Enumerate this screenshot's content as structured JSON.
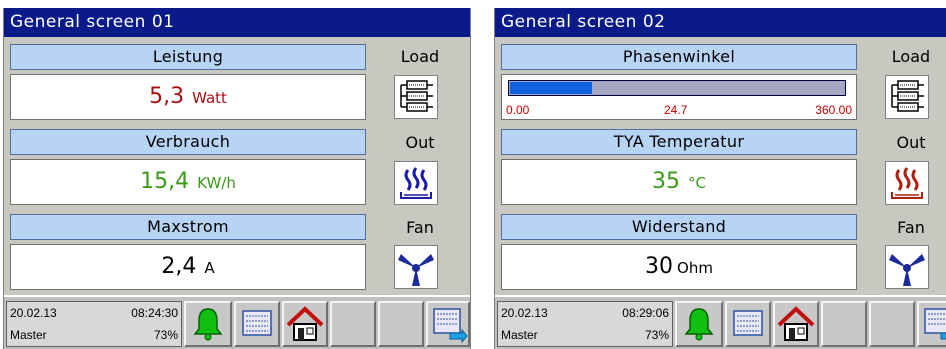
{
  "screens": [
    {
      "title": "General screen  01",
      "rows": [
        {
          "label": "Leistung",
          "value": "5,3",
          "unit": "Watt",
          "color": "#aa1010"
        },
        {
          "label": "Verbrauch",
          "value": "15,4",
          "unit": "KW/h",
          "color": "#3a9a1a"
        },
        {
          "label": "Maxstrom",
          "value": "2,4",
          "unit": "A",
          "color": "#000000"
        }
      ],
      "side": [
        {
          "label": "Load",
          "icon": "load-icon"
        },
        {
          "label": "Out",
          "icon": "heater-icon"
        },
        {
          "label": "Fan",
          "icon": "fan-icon"
        }
      ],
      "status": {
        "date": "20.02.13",
        "time": "08:24:30",
        "user": "Master",
        "percent": "73%"
      }
    },
    {
      "title": "General screen 02",
      "rows": [
        {
          "label": "Phasenwinkel",
          "progress": {
            "min": "0.00",
            "mid": "24.7",
            "max": "360.00",
            "fraction": 0.247
          }
        },
        {
          "label": "TYA Temperatur",
          "value": "35",
          "unit": "°C",
          "color": "#3a9a1a"
        },
        {
          "label": "Widerstand",
          "value": "30",
          "unit": "Ohm",
          "color": "#000000"
        }
      ],
      "side": [
        {
          "label": "Load",
          "icon": "load-icon"
        },
        {
          "label": "Out",
          "icon": "heater-icon"
        },
        {
          "label": "Fan",
          "icon": "fan-icon"
        }
      ],
      "status": {
        "date": "20.02.13",
        "time": "08:29:06",
        "user": "Master",
        "percent": "73%"
      }
    }
  ],
  "toolbar_icons": [
    "bell-icon",
    "list-icon",
    "home-icon",
    "blank-button",
    "blank-button",
    "next-screen-icon"
  ],
  "colors": {
    "title_bar": "#0a1a88",
    "header_fill": "#b8d4f4",
    "panel": "#c8c8c0",
    "progress_fill": "#1060e0",
    "progress_text": "#cc0000"
  }
}
